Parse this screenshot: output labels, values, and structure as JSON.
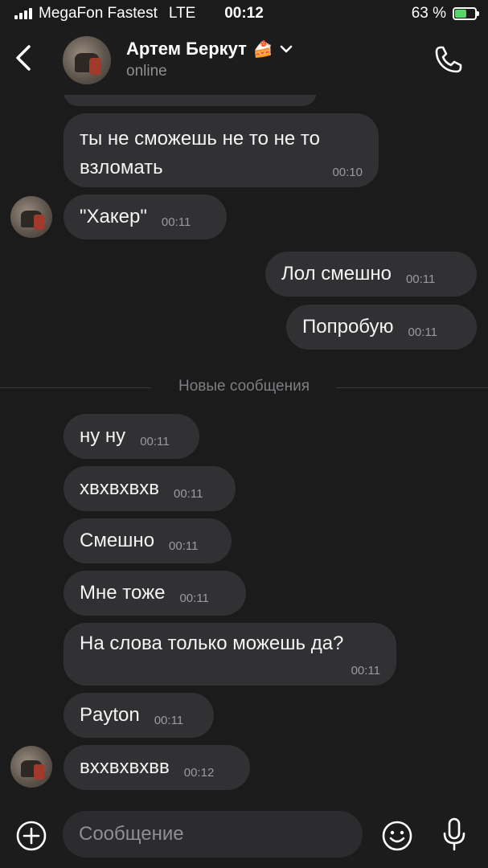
{
  "status_bar": {
    "carrier": "MegaFon Fastest",
    "network": "LTE",
    "time": "00:12",
    "battery": "63 %",
    "battery_level": 0.63
  },
  "header": {
    "back_icon": "chevron-left-icon",
    "name": "Артем Беркут",
    "name_emoji": "🍰",
    "status": "online",
    "call_icon": "phone-icon"
  },
  "messages": [
    {
      "text": "ты не сможешь не то не то взломать",
      "time": "00:10",
      "side": "in"
    },
    {
      "text": "\"Хакер\"",
      "time": "00:11",
      "side": "in"
    },
    {
      "text": "Лол смешно",
      "time": "00:11",
      "side": "out"
    },
    {
      "text": "Попробую",
      "time": "00:11",
      "side": "out"
    },
    {
      "text": "ну ну",
      "time": "00:11",
      "side": "in"
    },
    {
      "text": "хвхвхвхв",
      "time": "00:11",
      "side": "in"
    },
    {
      "text": "Смешно",
      "time": "00:11",
      "side": "in"
    },
    {
      "text": "Мне тоже",
      "time": "00:11",
      "side": "in"
    },
    {
      "text": "На слова только можешь да?",
      "time": "00:11",
      "side": "in"
    },
    {
      "text": "Payton",
      "time": "00:11",
      "side": "in"
    },
    {
      "text": "вххвхвхвв",
      "time": "00:12",
      "side": "in"
    }
  ],
  "divider": {
    "label": "Новые сообщения"
  },
  "composer": {
    "placeholder": "Сообщение",
    "plus_icon": "plus-circle-icon",
    "emoji_icon": "emoji-icon",
    "mic_icon": "microphone-icon"
  },
  "colors": {
    "background": "#1b1b1c",
    "bubble": "#313133",
    "battery_fill": "#59d66a"
  }
}
